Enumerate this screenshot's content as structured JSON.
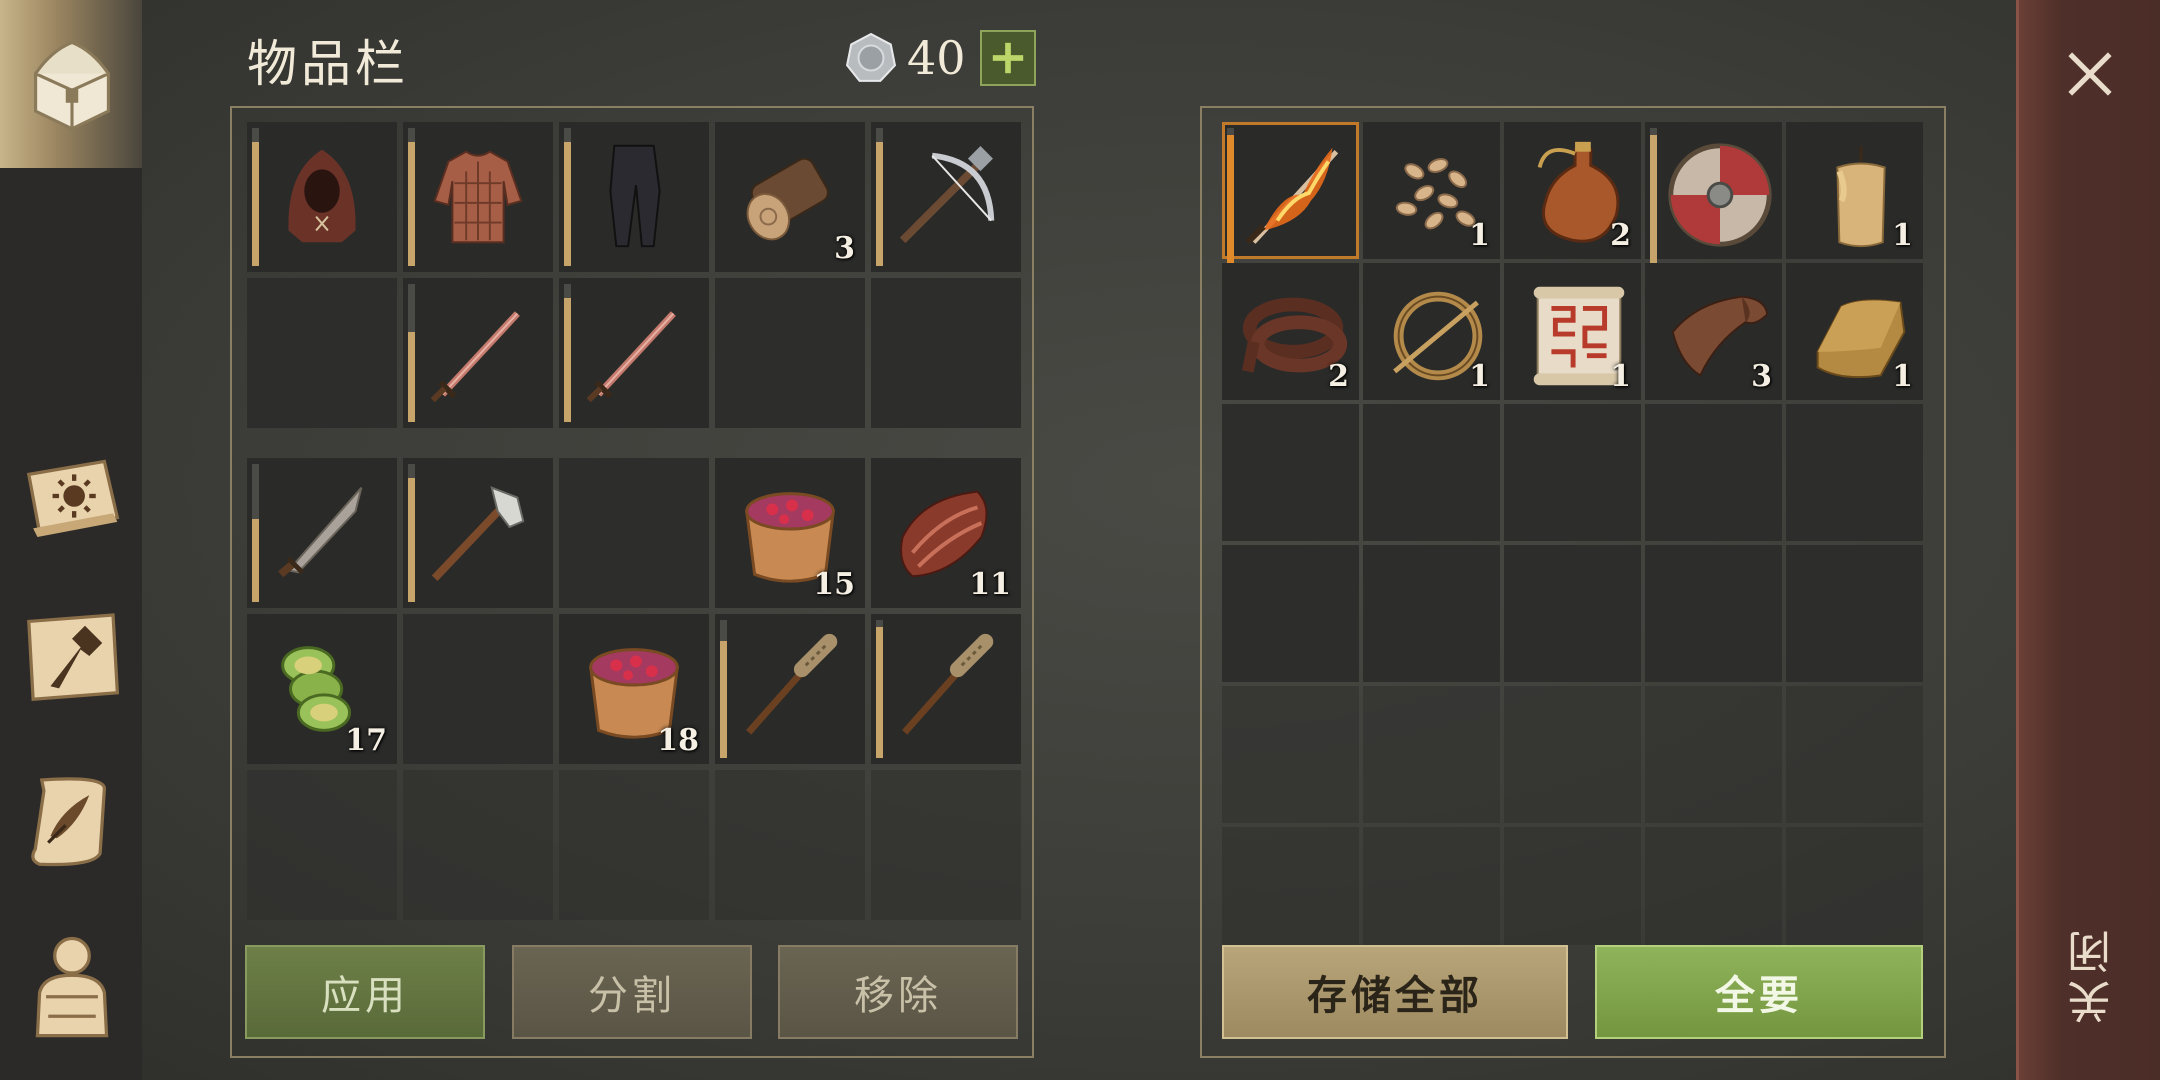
{
  "inventory": {
    "title": "物品栏",
    "coins": "40",
    "slots": [
      {
        "icon": "hood-icon",
        "qty": "",
        "durability": 0.9
      },
      {
        "icon": "padded-tunic-icon",
        "qty": "",
        "durability": 0.9
      },
      {
        "icon": "pants-icon",
        "qty": "",
        "durability": 0.9
      },
      {
        "icon": "log-icon",
        "qty": "3",
        "durability": null
      },
      {
        "icon": "crossbow-icon",
        "qty": "",
        "durability": 0.9
      },
      {
        "icon": "",
        "qty": "",
        "durability": null
      },
      {
        "icon": "sword-icon",
        "qty": "",
        "durability": 0.65
      },
      {
        "icon": "sword-icon",
        "qty": "",
        "durability": 0.9
      },
      {
        "icon": "",
        "qty": "",
        "durability": null
      },
      {
        "icon": "",
        "qty": "",
        "durability": null
      }
    ],
    "belt": [
      {
        "icon": "seax-icon",
        "qty": "",
        "durability": 0.6
      },
      {
        "icon": "axe-icon",
        "qty": "",
        "durability": 0.9
      },
      {
        "icon": "",
        "qty": "",
        "durability": null
      },
      {
        "icon": "berry-bucket-icon",
        "qty": "15",
        "durability": null
      },
      {
        "icon": "meat-icon",
        "qty": "11",
        "durability": null
      },
      {
        "icon": "cucumber-slices-icon",
        "qty": "17",
        "durability": null
      },
      {
        "icon": "",
        "qty": "",
        "durability": null
      },
      {
        "icon": "berry-bucket-icon",
        "qty": "18",
        "durability": null
      },
      {
        "icon": "club-icon",
        "qty": "",
        "durability": 0.85
      },
      {
        "icon": "club-icon",
        "qty": "",
        "durability": 0.95
      }
    ],
    "buttons": {
      "apply": "应用",
      "split": "分割",
      "remove": "移除"
    }
  },
  "container": {
    "slots": [
      {
        "icon": "flaming-sword-icon",
        "qty": "",
        "durability": 0.95,
        "selected": true
      },
      {
        "icon": "seeds-icon",
        "qty": "1",
        "durability": null
      },
      {
        "icon": "flask-icon",
        "qty": "2",
        "durability": null
      },
      {
        "icon": "shield-icon",
        "qty": "",
        "durability": 0.95
      },
      {
        "icon": "candle-icon",
        "qty": "1",
        "durability": null
      },
      {
        "icon": "leather-strap-icon",
        "qty": "2",
        "durability": null
      },
      {
        "icon": "brooch-icon",
        "qty": "1",
        "durability": null
      },
      {
        "icon": "scroll-icon",
        "qty": "1",
        "durability": null
      },
      {
        "icon": "leather-icon",
        "qty": "3",
        "durability": null
      },
      {
        "icon": "gold-bar-icon",
        "qty": "1",
        "durability": null
      }
    ],
    "buttons": {
      "store_all": "存储全部",
      "take_all": "全要"
    }
  },
  "close_label": "关闭",
  "colors": {
    "accent_green": "#8fb35a",
    "accent_gold": "#c7a56a",
    "selected": "#e08a2c"
  }
}
